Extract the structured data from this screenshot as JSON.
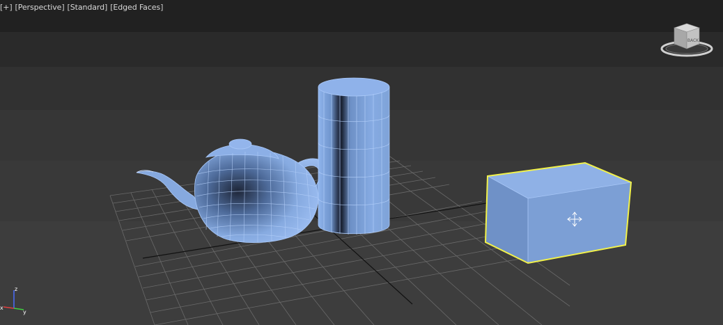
{
  "viewport": {
    "labels": [
      {
        "id": "plus",
        "text": "+"
      },
      {
        "id": "view",
        "text": "Perspective"
      },
      {
        "id": "shading",
        "text": "Standard"
      },
      {
        "id": "edges",
        "text": "Edged Faces"
      }
    ]
  },
  "viewcube": {
    "face_label": "BACK"
  },
  "axes": {
    "z_label": "z",
    "x_label": "x",
    "y_label": "y"
  },
  "colors": {
    "object_blue": "#7fa6e0",
    "wire_blue": "#9fc2f7",
    "selection_yellow": "#f2f24a",
    "grid": "#6a6a6a",
    "axis_z": "#4a6cff",
    "axis_x": "#e04040",
    "axis_y": "#40d040"
  },
  "scene": {
    "objects": [
      "teapot",
      "cylinder",
      "box"
    ],
    "selected": "box"
  }
}
